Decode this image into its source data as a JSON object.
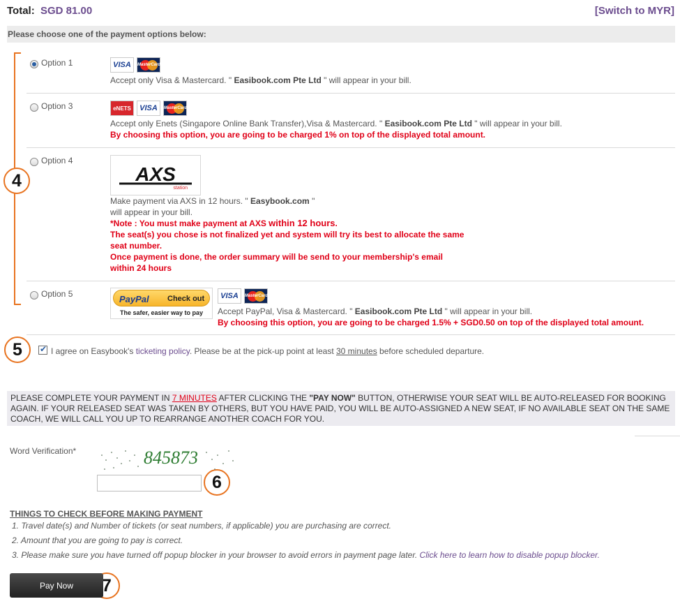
{
  "header": {
    "total_label": "Total:",
    "total_value": "SGD 81.00",
    "switch_link": "[Switch to MYR]"
  },
  "choose_prompt": "Please choose one of the payment options below:",
  "markers": {
    "m4": "4",
    "m5": "5",
    "m6": "6",
    "m7": "7"
  },
  "options": [
    {
      "label": "Option 1",
      "selected": true,
      "cards": [
        "VISA",
        "MasterCard"
      ],
      "desc_pre": "Accept only Visa & Mastercard. \" ",
      "desc_bold": "Easibook.com Pte Ltd",
      "desc_post": " \" will appear in your bill."
    },
    {
      "label": "Option 3",
      "selected": false,
      "cards": [
        "eNETS",
        "VISA",
        "MasterCard"
      ],
      "desc_pre": "Accept only Enets (Singapore Online Bank Transfer),Visa & Mastercard. \" ",
      "desc_bold": "Easibook.com Pte Ltd",
      "desc_post": " \" will appear in your bill.",
      "warning": "By choosing this option, you are going to be charged 1% on top of the displayed total amount."
    },
    {
      "label": "Option 4",
      "selected": false,
      "logo": "AXS",
      "logo_sub": "station",
      "desc_pre": "Make payment via AXS in 12 hours. \" ",
      "desc_bold": "Easybook.com",
      "desc_post": " \"",
      "desc_line2": "will appear in your bill.",
      "note_1a": "*Note : You must make payment at AXS ",
      "note_1b": "within 12 hours",
      "note_1c": ".",
      "note_2": "The seat(s) you chose is not finalized yet and system will try its best to allocate the same",
      "note_3": "seat number.",
      "note_4": "Once payment is done, the order summary will be send to your membership's email",
      "note_5": "within 24 hours"
    },
    {
      "label": "Option 5",
      "selected": false,
      "paypal_logo": "PayPal",
      "paypal_button": "Check out",
      "paypal_tagline": "The safer, easier way to pay",
      "cards": [
        "VISA",
        "MasterCard"
      ],
      "desc_pre": "Accept PayPal, Visa & Mastercard. \" ",
      "desc_bold": "Easibook.com Pte Ltd",
      "desc_post": " \" will appear in your bill.",
      "warning": "By choosing this option, you are going to be charged 1.5% + SGD0.50 on top of the displayed total amount."
    }
  ],
  "agree": {
    "checked": true,
    "text_1": "I agree on Easybook's ",
    "link": "ticketing policy",
    "text_2": ". Please be at the pick-up point at least ",
    "underline": "30 minutes",
    "text_3": " before scheduled departure."
  },
  "notice": {
    "part_1": "PLEASE COMPLETE YOUR PAYMENT IN ",
    "minutes": "7 MINUTES",
    "part_2": " AFTER CLICKING THE ",
    "pay_now": "\"PAY NOW\"",
    "part_3": " BUTTON, OTHERWISE YOUR SEAT WILL BE AUTO-RELEASED FOR BOOKING AGAIN. IF YOUR RELEASED SEAT WAS TAKEN BY OTHERS, BUT YOU HAVE PAID, YOU WILL BE AUTO-ASSIGNED A NEW SEAT, IF NO AVAILABLE SEAT ON THE SAME COACH, WE WILL CALL YOU UP TO REARRANGE ANOTHER COACH FOR YOU."
  },
  "verification": {
    "label": "Word Verification*",
    "captcha_text": "845873",
    "input_value": ""
  },
  "things": {
    "title": "THINGS TO CHECK BEFORE MAKING PAYMENT",
    "item_1": "1. Travel date(s) and Number of tickets (or seat numbers, if applicable) you are purchasing are correct.",
    "item_2": "2. Amount that you are going to pay is correct.",
    "item_3_text": "3. Please make sure you have turned off popup blocker in your browser to avoid errors in payment page later. ",
    "item_3_link": "Click here to learn how to disable popup blocker."
  },
  "pay_button": "Pay Now",
  "colors": {
    "accent_purple": "#6b4c8e",
    "warning_red": "#e00017",
    "marker_orange": "#e8731f"
  }
}
